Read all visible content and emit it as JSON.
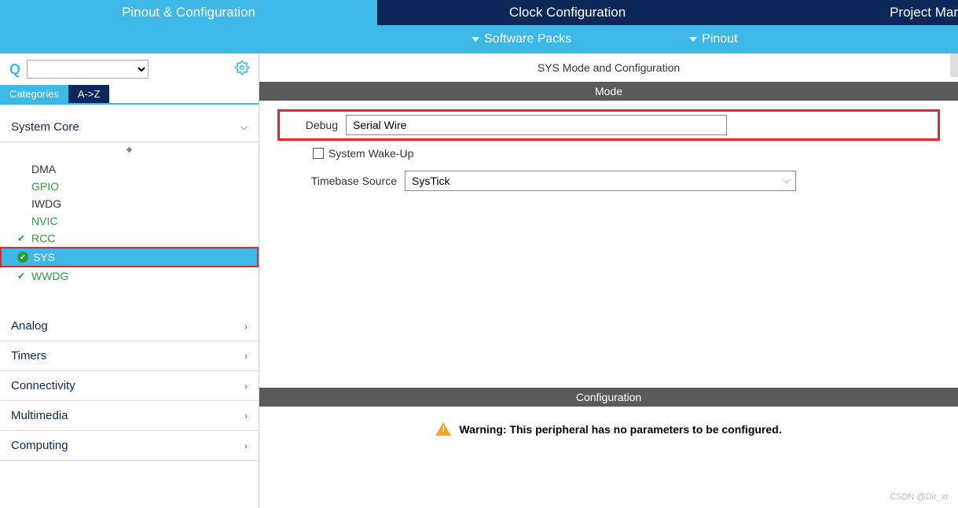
{
  "topTabs": {
    "pinout": "Pinout & Configuration",
    "clock": "Clock Configuration",
    "project": "Project Mar"
  },
  "subBar": {
    "software": "Software Packs",
    "pinout": "Pinout"
  },
  "sidebar": {
    "catTabs": {
      "categories": "Categories",
      "az": "A->Z"
    },
    "systemCore": {
      "label": "System Core"
    },
    "items": {
      "dma": "DMA",
      "gpio": "GPIO",
      "iwdg": "IWDG",
      "nvic": "NVIC",
      "rcc": "RCC",
      "sys": "SYS",
      "wwdg": "WWDG"
    },
    "groups": {
      "analog": "Analog",
      "timers": "Timers",
      "connectivity": "Connectivity",
      "multimedia": "Multimedia",
      "computing": "Computing"
    }
  },
  "content": {
    "title": "SYS Mode and Configuration",
    "modeHeader": "Mode",
    "debug": {
      "label": "Debug",
      "value": "Serial Wire"
    },
    "wakeup": {
      "label": "System Wake-Up",
      "checked": false
    },
    "timebase": {
      "label": "Timebase Source",
      "value": "SysTick"
    },
    "configHeader": "Configuration",
    "warning": "Warning:  This peripheral has no parameters to be configured."
  },
  "watermark": "CSDN @Dir_xr"
}
